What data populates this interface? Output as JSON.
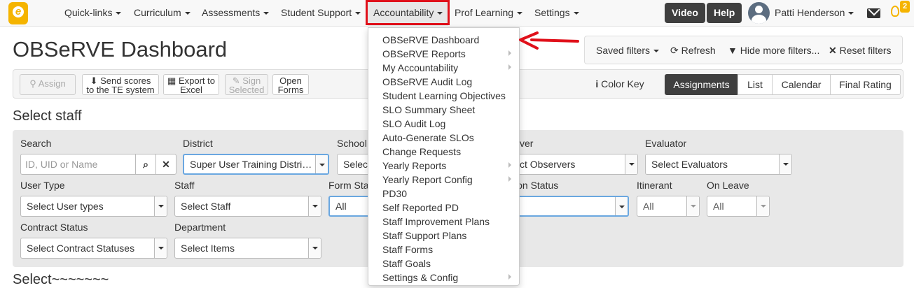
{
  "nav": {
    "logo": "e",
    "items": [
      "Quick-links",
      "Curriculum",
      "Assessments",
      "Student Support",
      "Accountability",
      "Prof Learning",
      "Settings"
    ],
    "video": "Video",
    "help": "Help",
    "user": "Patti Henderson",
    "notif_count": "2"
  },
  "page": {
    "title": "OBSeRVE Dashboard"
  },
  "filterbar": {
    "saved": "Saved filters",
    "refresh": "Refresh",
    "hide": "Hide more filters...",
    "reset": "Reset filters"
  },
  "toolbar": {
    "assign": "Assign",
    "send1": "Send scores",
    "send2": "to the TE system",
    "export1": "Export to",
    "export2": "Excel",
    "sign1": "Sign",
    "sign2": "Selected",
    "open1": "Open",
    "open2": "Forms",
    "colorkey": "Color Key",
    "views": [
      "Assignments",
      "List",
      "Calendar",
      "Final Rating"
    ]
  },
  "select_staff": {
    "title": "Select staff",
    "search_label": "Search",
    "search_placeholder": "ID, UID or Name",
    "district_label": "District",
    "district_value": "Super User Training Distri…",
    "school_label": "School",
    "school_value": "Selec",
    "observer_label": "ver",
    "observer_value": "ct Observers",
    "evaluator_label": "Evaluator",
    "evaluator_value": "Select Evaluators",
    "usertype_label": "User Type",
    "usertype_value": "Select User types",
    "staff_label": "Staff",
    "staff_value": "Select Staff",
    "formstatus_label": "Form Sta",
    "formstatus_value": "All",
    "iostatus_label": "ion Status",
    "itinerant_label": "Itinerant",
    "itinerant_value": "All",
    "onleave_label": "On Leave",
    "onleave_value": "All",
    "contract_label": "Contract Status",
    "contract_value": "Select Contract Statuses",
    "department_label": "Department",
    "department_value": "Select Items"
  },
  "select_section2": "Select~~~~~~~",
  "dropdown": {
    "items": [
      "OBSeRVE Dashboard",
      "OBSeRVE Reports",
      "My Accountability",
      "OBSeRVE Audit Log",
      "Student Learning Objectives",
      "SLO Summary Sheet",
      "SLO Audit Log",
      "Auto-Generate SLOs",
      "Change Requests",
      "Yearly Reports",
      "Yearly Report Config",
      "PD30",
      "Self Reported PD",
      "Staff Improvement Plans",
      "Staff Support Plans",
      "Staff Forms",
      "Staff Goals",
      "Settings & Config"
    ]
  },
  "colors": {
    "highlight": "#e0101a",
    "accent": "#f5b400",
    "active": "#3f3f3f"
  }
}
